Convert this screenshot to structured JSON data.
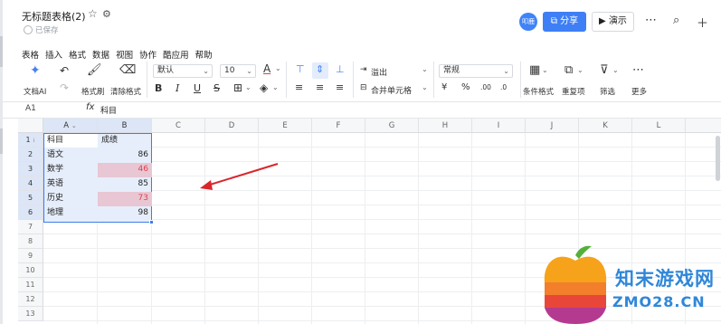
{
  "app": {
    "title": "无标题表格(2)",
    "save_status": "已保存",
    "avatar_text": "叩鹿",
    "share_label": "分享",
    "present_label": "演示"
  },
  "menu": [
    "表格",
    "插入",
    "格式",
    "数据",
    "视图",
    "协作",
    "酷应用",
    "帮助"
  ],
  "toolbar": {
    "ai_label": "文档AI",
    "format_painter_label": "格式刷",
    "clear_format_label": "清除格式",
    "font_name": "默认",
    "font_size": "10",
    "wrap_label": "溢出",
    "merge_label": "合并单元格",
    "number_format": "常规",
    "conditional_format_label": "条件格式",
    "duplicate_label": "重复项",
    "filter_label": "筛选",
    "more_label": "更多"
  },
  "formula_bar": {
    "cell_ref": "A1",
    "fx": "fx",
    "content": "科目"
  },
  "grid": {
    "columns": [
      "A",
      "B",
      "C",
      "D",
      "E",
      "F",
      "G",
      "H",
      "I",
      "J",
      "K",
      "L"
    ],
    "rows": [
      "1",
      "2",
      "3",
      "4",
      "5",
      "6",
      "7",
      "8",
      "9",
      "10",
      "11",
      "12",
      "13"
    ],
    "header": {
      "a": "科目",
      "b": "成绩"
    },
    "data": [
      {
        "subject": "语文",
        "score": "86"
      },
      {
        "subject": "数学",
        "score": "46"
      },
      {
        "subject": "英语",
        "score": "85"
      },
      {
        "subject": "历史",
        "score": "73"
      },
      {
        "subject": "地理",
        "score": "98"
      }
    ]
  },
  "watermark": {
    "name": "知末游戏网",
    "url": "ZMO28.CN"
  },
  "colors": {
    "accent": "#3f7ff5",
    "selection_fill": "#e6eefb",
    "highlight_fill": "#e9c6d3",
    "highlight_text": "#e0404a",
    "arrow": "#d9262b"
  }
}
